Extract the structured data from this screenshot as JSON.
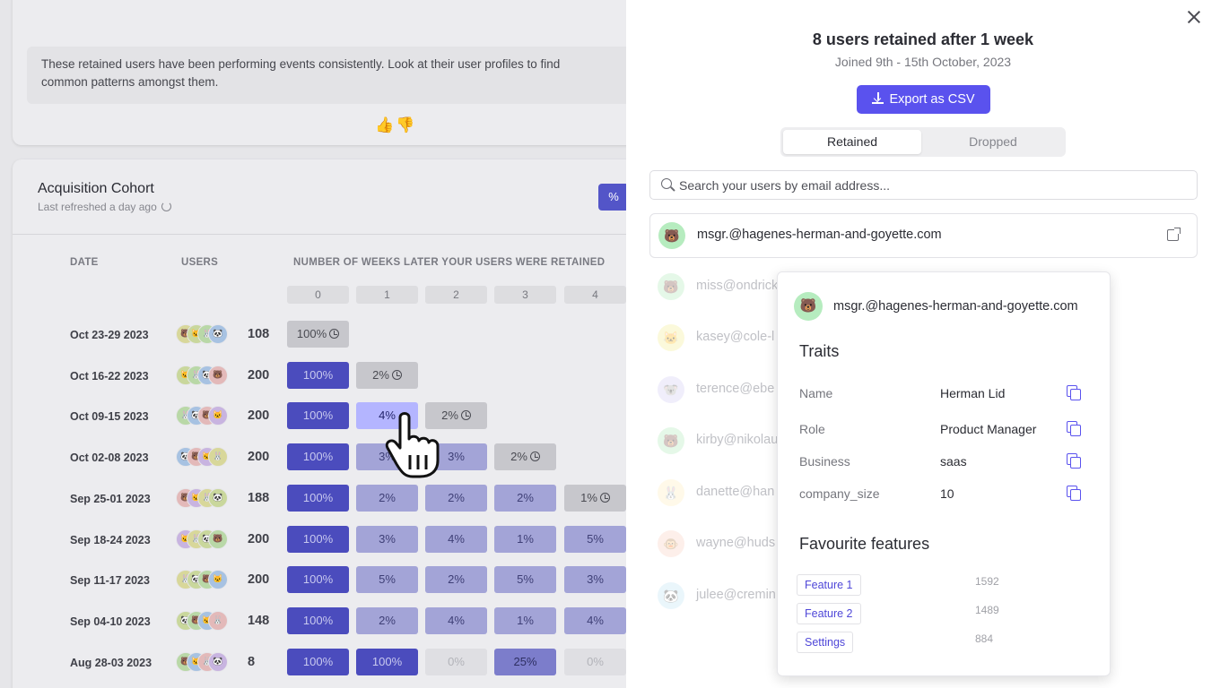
{
  "insight": {
    "text": "These retained users have been performing events consistently. Look at their user profiles to find common patterns amongst them.",
    "thumbs_up": "👍",
    "thumbs_down": "👎"
  },
  "cohort": {
    "title": "Acquisition Cohort",
    "subtitle": "Last refreshed a day ago",
    "toggle_label": "%",
    "headers": {
      "date": "DATE",
      "users": "USERS",
      "weeks": "NUMBER OF WEEKS LATER YOUR USERS WERE RETAINED"
    },
    "weeks": [
      "0",
      "1",
      "2",
      "3",
      "4"
    ],
    "rows": [
      {
        "date": "Oct 23-29 2023",
        "users": "108",
        "cells": [
          "100%",
          "",
          "",
          "",
          ""
        ]
      },
      {
        "date": "Oct 16-22 2023",
        "users": "200",
        "cells": [
          "100%",
          "2%",
          "",
          "",
          ""
        ]
      },
      {
        "date": "Oct 09-15 2023",
        "users": "200",
        "cells": [
          "100%",
          "4%",
          "2%",
          "",
          ""
        ]
      },
      {
        "date": "Oct 02-08 2023",
        "users": "200",
        "cells": [
          "100%",
          "3%",
          "3%",
          "2%",
          ""
        ]
      },
      {
        "date": "Sep 25-01 2023",
        "users": "188",
        "cells": [
          "100%",
          "2%",
          "2%",
          "2%",
          "1%"
        ]
      },
      {
        "date": "Sep 18-24 2023",
        "users": "200",
        "cells": [
          "100%",
          "3%",
          "4%",
          "1%",
          "5%"
        ]
      },
      {
        "date": "Sep 11-17 2023",
        "users": "200",
        "cells": [
          "100%",
          "5%",
          "2%",
          "5%",
          "3%"
        ]
      },
      {
        "date": "Sep 04-10 2023",
        "users": "148",
        "cells": [
          "100%",
          "2%",
          "4%",
          "1%",
          "4%"
        ]
      },
      {
        "date": "Aug 28-03 2023",
        "users": "8",
        "cells": [
          "100%",
          "100%",
          "0%",
          "25%",
          "0%"
        ]
      }
    ]
  },
  "panel": {
    "title": "8 users retained after 1 week",
    "subtitle": "Joined 9th - 15th October, 2023",
    "export_label": "Export as CSV",
    "tabs": [
      "Retained",
      "Dropped"
    ],
    "active_tab": "Retained",
    "search_placeholder": "Search your users by email address...",
    "users": [
      {
        "email": "msgr.@hagenes-herman-and-goyette.com",
        "avatar": "🐻",
        "color": "#b6ecbf"
      },
      {
        "email": "miss@ondrick",
        "avatar": "🐻",
        "color": "#b6ecbf"
      },
      {
        "email": "kasey@cole-l",
        "avatar": "🐱",
        "color": "#f4ef9a"
      },
      {
        "email": "terence@ebe",
        "avatar": "🐨",
        "color": "#d6d0f5"
      },
      {
        "email": "kirby@nikolau",
        "avatar": "🐻",
        "color": "#b6ecbf"
      },
      {
        "email": "danette@han",
        "avatar": "🐰",
        "color": "#fff0c2"
      },
      {
        "email": "wayne@huds",
        "avatar": "🐵",
        "color": "#fbd3c6"
      },
      {
        "email": "julee@cremin",
        "avatar": "🐼",
        "color": "#c6e7f6"
      }
    ]
  },
  "popover": {
    "email": "msgr.@hagenes-herman-and-goyette.com",
    "avatar": "🐻",
    "traits_heading": "Traits",
    "traits": [
      {
        "key": "Name",
        "value": "Herman Lid"
      },
      {
        "key": "Role",
        "value": "Product Manager"
      },
      {
        "key": "Business",
        "value": "saas"
      },
      {
        "key": "company_size",
        "value": "10"
      }
    ],
    "features_heading": "Favourite features",
    "features": [
      {
        "name": "Feature 1",
        "count": "1592"
      },
      {
        "name": "Feature 2",
        "count": "1489"
      },
      {
        "name": "Settings",
        "count": "884"
      }
    ]
  },
  "colors": {
    "accent": "#5a52ee",
    "cell_full": "#4b4cbd",
    "cell_low": "#a3a4d7",
    "cell_highlight": "#b4b5ff"
  }
}
